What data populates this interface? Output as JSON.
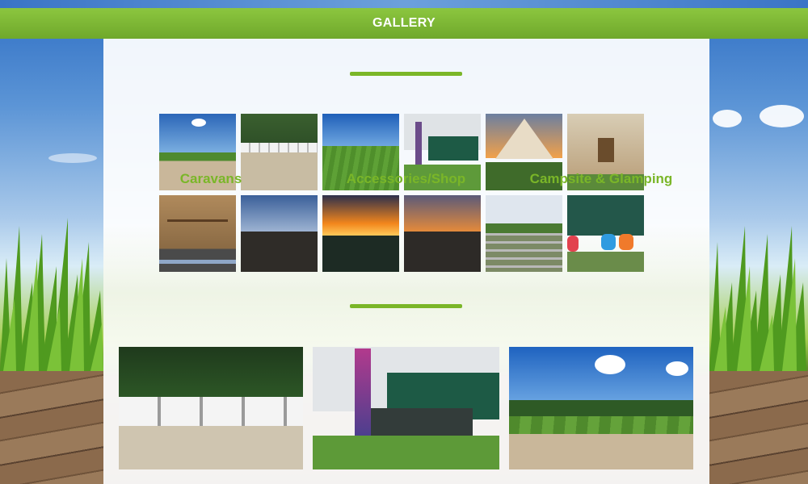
{
  "header": {
    "title": "GALLERY"
  },
  "gallery": {
    "thumbnails": [
      {
        "subject": "campsite-field"
      },
      {
        "subject": "caravans-row"
      },
      {
        "subject": "grass-field"
      },
      {
        "subject": "awning-display"
      },
      {
        "subject": "bell-tent-sunset"
      },
      {
        "subject": "bell-tent-interior"
      },
      {
        "subject": "welcome-sign"
      },
      {
        "subject": "evening-sky"
      },
      {
        "subject": "sunset-orange"
      },
      {
        "subject": "sunset-trees"
      },
      {
        "subject": "gate-field"
      },
      {
        "subject": "camping-chairs"
      }
    ]
  },
  "cards": [
    {
      "caption": "Caravans"
    },
    {
      "caption": "Accessories/Shop"
    },
    {
      "caption": "Campsite & Glamping"
    }
  ],
  "colors": {
    "accent": "#7ab628",
    "header": "#7cb733"
  }
}
